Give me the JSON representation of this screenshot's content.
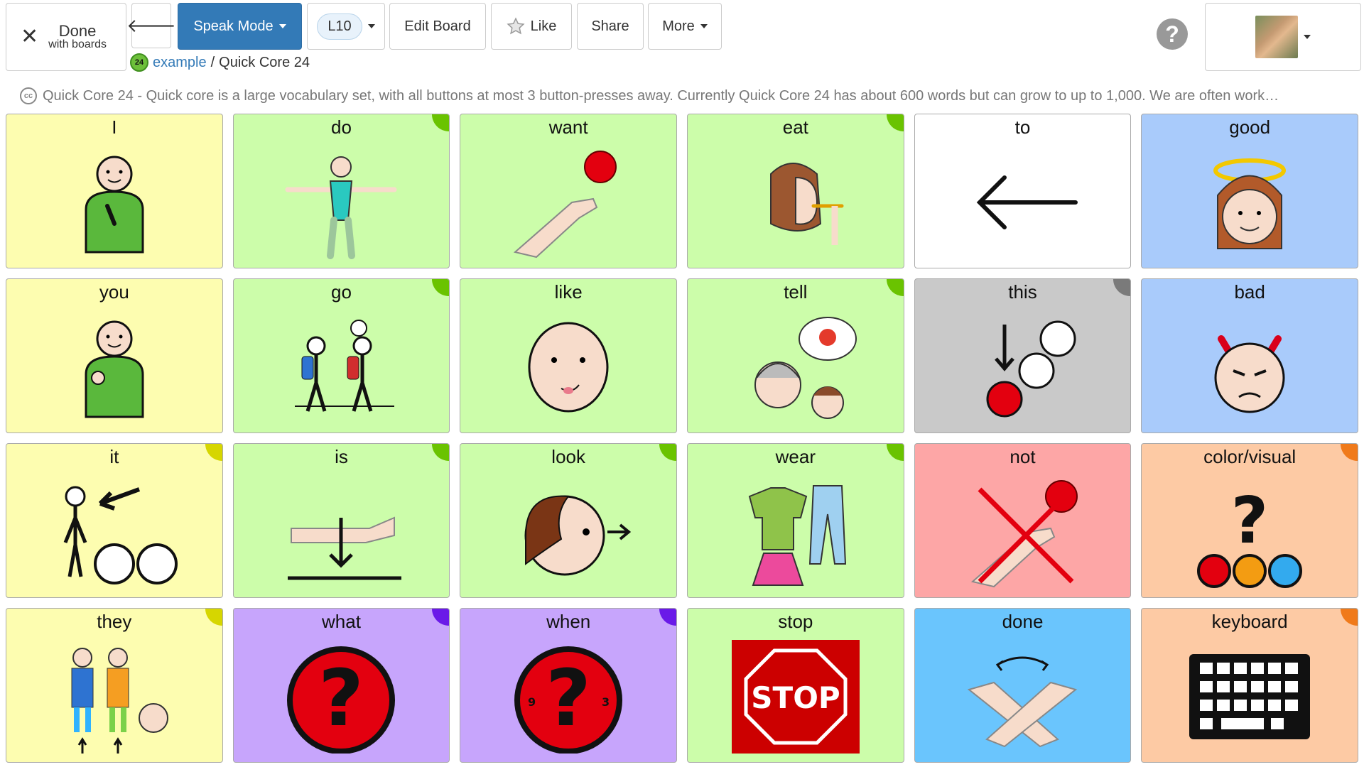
{
  "header": {
    "done_label": "Done",
    "done_sub": "with boards",
    "back_icon": "arrow-left-icon",
    "speak_label": "Speak Mode",
    "level_label": "L10",
    "edit_label": "Edit Board",
    "like_label": "Like",
    "share_label": "Share",
    "more_label": "More",
    "help_icon": "question-circle-icon"
  },
  "breadcrumb": {
    "badge": "24",
    "user_link": "example",
    "separator": "/",
    "board": "Quick Core 24"
  },
  "description": {
    "license_badge": "cc",
    "text": "Quick Core 24 - Quick core is a large vocabulary set, with all buttons at most 3 button-presses away. Currently Quick Core 24 has about 600 words but can grow to up to 1,000. We are often work…"
  },
  "colors": {
    "primary": "#337ab7",
    "yellow": "#fdfdb0",
    "green": "#ccfdaa",
    "white": "#ffffff",
    "blue": "#a9cbfb",
    "gray": "#c9c9c9",
    "pink": "#fda6a6",
    "orange": "#fdcaa4",
    "purple": "#c7a5fc",
    "sky": "#6ac5fd"
  },
  "cells": [
    {
      "label": "I",
      "bg": "#fdfdb0",
      "corner": null,
      "icon": "person-pointing-self-icon"
    },
    {
      "label": "do",
      "bg": "#ccfdaa",
      "corner": "#6ac300",
      "icon": "dancer-icon"
    },
    {
      "label": "want",
      "bg": "#ccfdaa",
      "corner": null,
      "icon": "hand-reaching-ball-icon"
    },
    {
      "label": "eat",
      "bg": "#ccfdaa",
      "corner": "#6ac300",
      "icon": "girl-eating-icon"
    },
    {
      "label": "to",
      "bg": "#ffffff",
      "corner": null,
      "icon": "arrow-left-icon"
    },
    {
      "label": "good",
      "bg": "#a9cbfb",
      "corner": null,
      "icon": "angel-face-icon"
    },
    {
      "label": "you",
      "bg": "#fdfdb0",
      "corner": null,
      "icon": "person-pointing-you-icon"
    },
    {
      "label": "go",
      "bg": "#ccfdaa",
      "corner": "#6ac300",
      "icon": "hikers-icon"
    },
    {
      "label": "like",
      "bg": "#ccfdaa",
      "corner": null,
      "icon": "face-licking-icon"
    },
    {
      "label": "tell",
      "bg": "#ccfdaa",
      "corner": "#6ac300",
      "icon": "storytelling-icon"
    },
    {
      "label": "this",
      "bg": "#c9c9c9",
      "corner": "#7a7a7a",
      "icon": "pointing-down-circle-icon"
    },
    {
      "label": "bad",
      "bg": "#a9cbfb",
      "corner": null,
      "icon": "devil-face-icon"
    },
    {
      "label": "it",
      "bg": "#fdfdb0",
      "corner": "#d6d600",
      "icon": "person-arrow-icon"
    },
    {
      "label": "is",
      "bg": "#ccfdaa",
      "corner": "#6ac300",
      "icon": "hand-down-arrow-icon"
    },
    {
      "label": "look",
      "bg": "#ccfdaa",
      "corner": "#6ac300",
      "icon": "head-looking-icon"
    },
    {
      "label": "wear",
      "bg": "#ccfdaa",
      "corner": "#6ac300",
      "icon": "clothes-icon"
    },
    {
      "label": "not",
      "bg": "#fda6a6",
      "corner": null,
      "icon": "crossed-out-hand-icon"
    },
    {
      "label": "color/visual",
      "bg": "#fdcaa4",
      "corner": "#f07a1a",
      "icon": "color-question-icon"
    },
    {
      "label": "they",
      "bg": "#fdfdb0",
      "corner": "#d6d600",
      "icon": "group-people-icon"
    },
    {
      "label": "what",
      "bg": "#c7a5fc",
      "corner": "#6a1ae8",
      "icon": "question-mark-icon"
    },
    {
      "label": "when",
      "bg": "#c7a5fc",
      "corner": "#6a1ae8",
      "icon": "clock-question-icon"
    },
    {
      "label": "stop",
      "bg": "#ccfdaa",
      "corner": null,
      "icon": "stop-sign-icon",
      "sign_text": "STOP"
    },
    {
      "label": "done",
      "bg": "#6ac5fd",
      "corner": null,
      "icon": "crossed-hands-icon"
    },
    {
      "label": "keyboard",
      "bg": "#fdcaa4",
      "corner": "#f07a1a",
      "icon": "keyboard-icon"
    }
  ]
}
